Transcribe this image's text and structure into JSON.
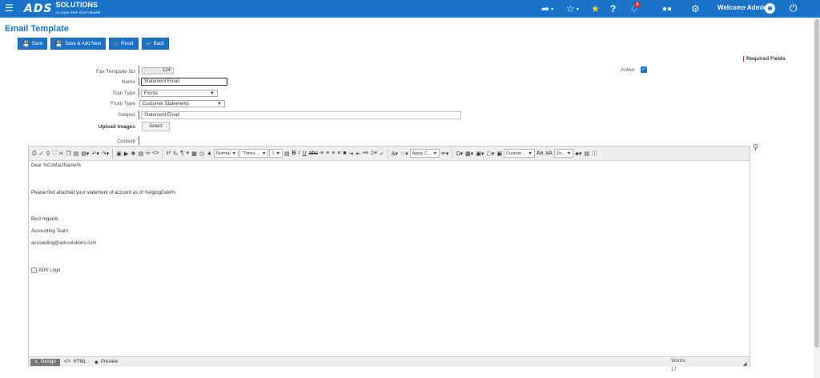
{
  "topbar": {
    "logo_main": "ADS",
    "logo_solutions": "SOLUTIONS",
    "logo_tagline": "CLOUD ERP SOFTWARE",
    "welcome": "Welcome Admin",
    "notification_count": "6",
    "icons": [
      "menu-icon",
      "share-icon",
      "star-outline-icon",
      "star-icon",
      "help-icon",
      "bell-icon",
      "users-icon",
      "gear-icon",
      "user-circle-icon",
      "power-icon"
    ]
  },
  "page": {
    "title": "Email Template"
  },
  "actions": {
    "save": "Save",
    "save_add_new": "Save & Add New",
    "reset": "Reset",
    "back": "Back"
  },
  "required_note": "Required Fields",
  "form": {
    "fax_template_no_label": "Fax Template No",
    "fax_template_no_value": "124",
    "name_label": "Name",
    "name_value": "Statement Email",
    "tran_type_label": "Tran Type",
    "tran_type_value": "Forms",
    "from_type_label": "From Type",
    "from_type_value": "Customer Statements",
    "subject_label": "Subject",
    "subject_value": "Statement Email",
    "upload_images_label": "Upload Images",
    "select_button": "Select",
    "content_label": "Content",
    "active_label": "Active",
    "active_checked": true
  },
  "editor": {
    "toolbar": {
      "format": "Normal",
      "font": "\"Times ...",
      "size": "1",
      "apply_css": "Apply C...",
      "custom": "Custom ...",
      "zoom": "Zo..."
    },
    "content_lines": [
      "Dear %ContactName%",
      "Please find attached your statement of account as of %AgingDate%",
      "Best regards",
      "Accounting Team",
      "accounting@adssolutions.com"
    ],
    "image_alt": "ADS Logo",
    "modes": {
      "design": "Design",
      "html": "HTML",
      "preview": "Preview"
    },
    "words_label": "Words:",
    "words_count": "17"
  },
  "colors": {
    "primary": "#1b73c9",
    "required": "#c0392b"
  }
}
